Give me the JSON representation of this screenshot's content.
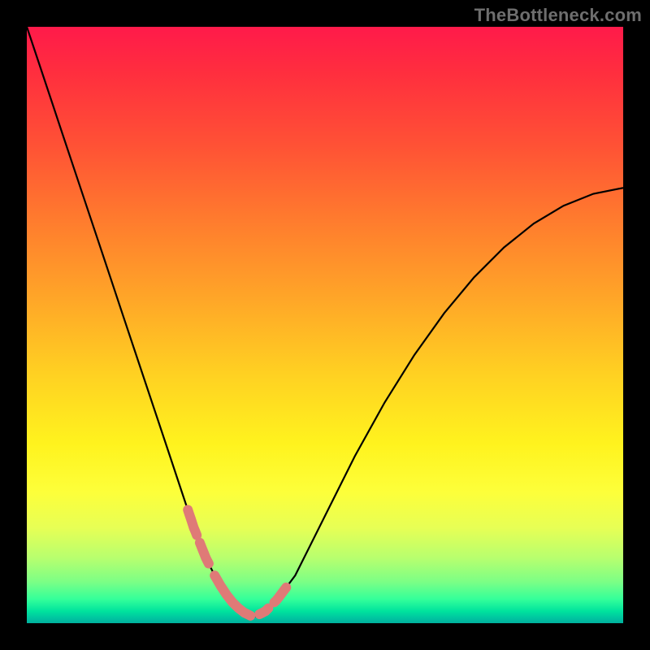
{
  "watermark": "TheBottleneck.com",
  "chart_data": {
    "type": "line",
    "title": "",
    "xlabel": "",
    "ylabel": "",
    "xlim": [
      0,
      100
    ],
    "ylim": [
      0,
      100
    ],
    "grid": false,
    "legend": false,
    "annotations": [],
    "series": [
      {
        "name": "bottleneck-curve",
        "x": [
          0,
          2,
          4,
          6,
          8,
          10,
          12,
          14,
          16,
          18,
          20,
          22,
          24,
          26,
          28,
          30,
          32,
          34,
          36,
          38,
          40,
          42,
          45,
          50,
          55,
          60,
          65,
          70,
          75,
          80,
          85,
          90,
          95,
          100
        ],
        "y": [
          100,
          94,
          88,
          82,
          76,
          70,
          64,
          58,
          52,
          46,
          40,
          34,
          28,
          22,
          16,
          11,
          7,
          4,
          2,
          1,
          2,
          4,
          8,
          18,
          28,
          37,
          45,
          52,
          58,
          63,
          67,
          70,
          72,
          73
        ]
      }
    ],
    "highlight_band": {
      "name": "optimal-zone-beads",
      "x_range": [
        27,
        44
      ],
      "segments_x": [
        [
          27,
          28.5
        ],
        [
          29,
          30.5
        ],
        [
          31.5,
          37.5
        ],
        [
          39,
          40.5
        ],
        [
          41.5,
          43.5
        ]
      ]
    },
    "background_gradient": {
      "stops": [
        {
          "pos": 0.0,
          "hex": "#ff1a4a"
        },
        {
          "pos": 0.2,
          "hex": "#ff5235"
        },
        {
          "pos": 0.45,
          "hex": "#ffa428"
        },
        {
          "pos": 0.7,
          "hex": "#fff31e"
        },
        {
          "pos": 0.9,
          "hex": "#7dff85"
        },
        {
          "pos": 1.0,
          "hex": "#00b09e"
        }
      ]
    }
  }
}
